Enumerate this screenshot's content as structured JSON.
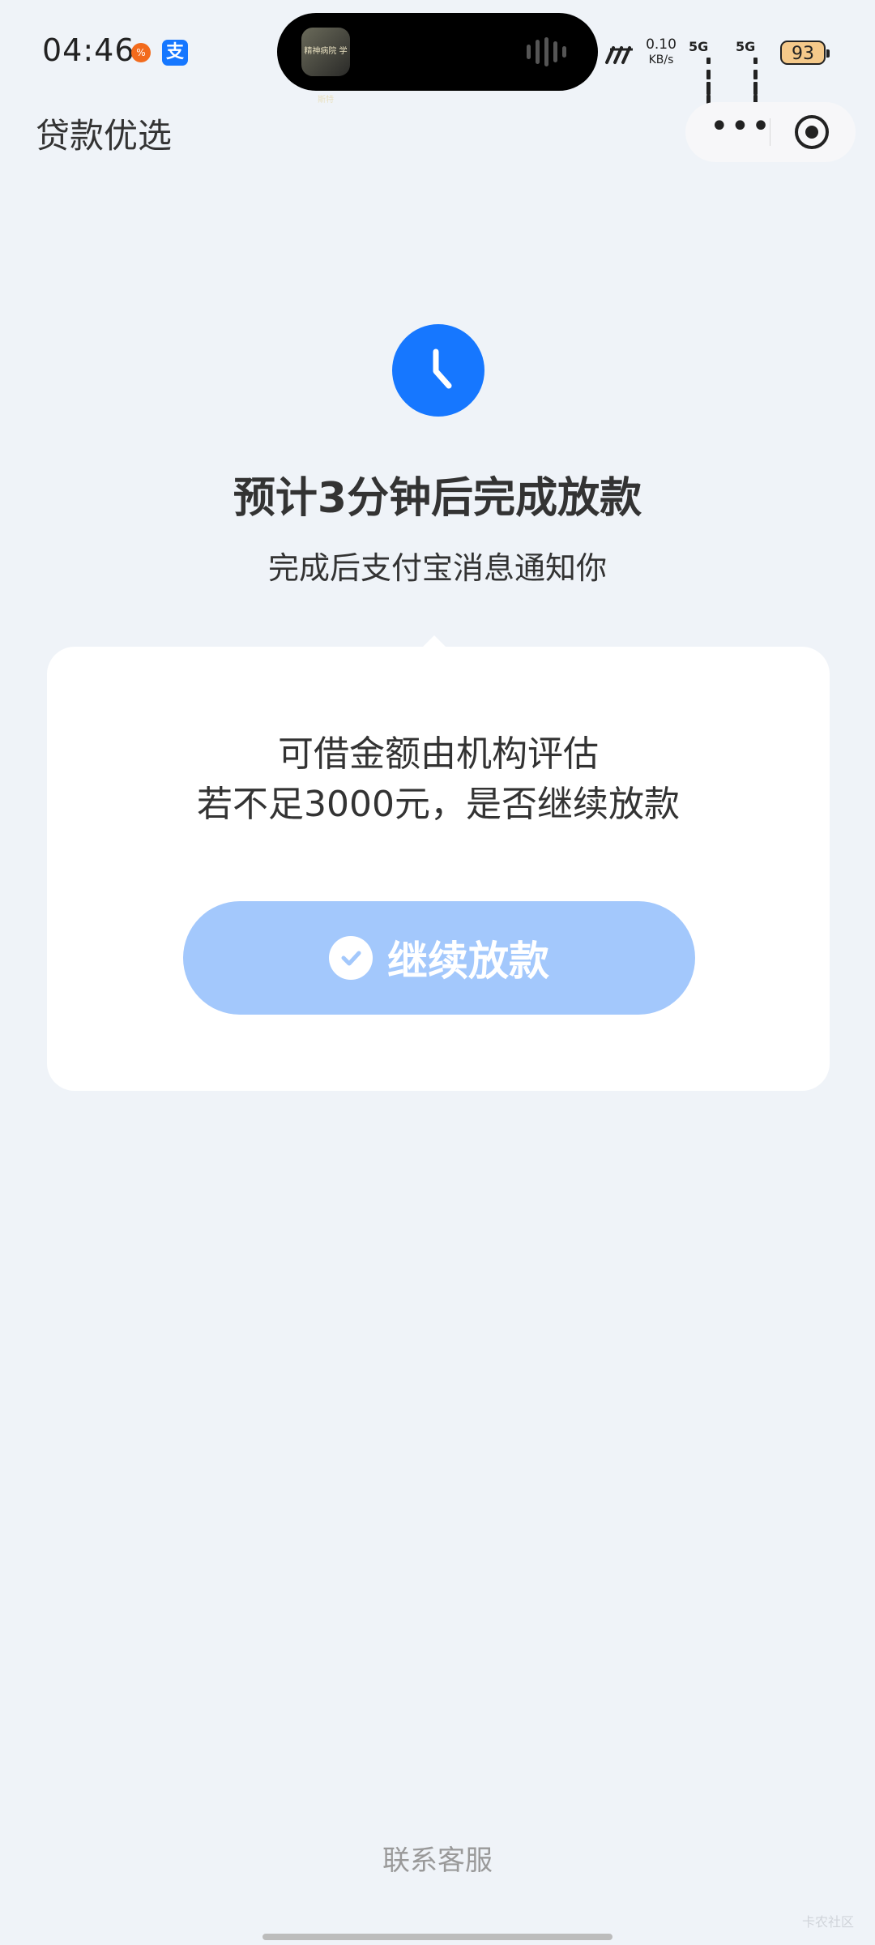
{
  "status_bar": {
    "time": "04:46",
    "net_speed_value": "0.10",
    "net_speed_unit": "KB/s",
    "signal1_label": "5G",
    "signal2_label": "5G",
    "battery": "93",
    "island_thumb_text": "精神病院 学斯特"
  },
  "nav": {
    "title": "贷款优选",
    "more_label": "•••"
  },
  "main": {
    "headline": "预计3分钟后完成放款",
    "subline": "完成后支付宝消息通知你",
    "card_line1": "可借金额由机构评估",
    "card_line2": "若不足3000元，是否继续放款",
    "button_label": "继续放款"
  },
  "footer": {
    "contact_label": "联系客服",
    "watermark": "卡农社区"
  },
  "colors": {
    "accent": "#1677ff",
    "button_bg": "#a3c8fc",
    "page_bg": "#eff3f8"
  },
  "icons": {
    "clock": "clock-icon",
    "check": "check-circle-icon",
    "more": "more-dots-icon",
    "close_target": "target-circle-icon"
  }
}
